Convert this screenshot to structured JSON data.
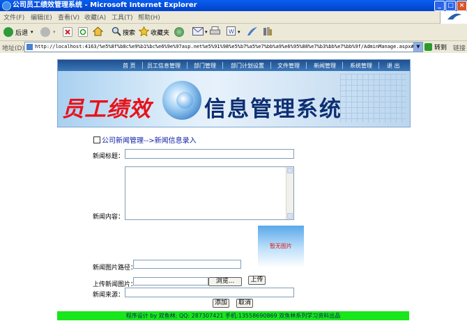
{
  "window": {
    "title": "公司员工绩效管理系统 - Microsoft Internet Explorer",
    "controls": [
      "_",
      "□",
      "×"
    ]
  },
  "menu": {
    "items": [
      "文件(F)",
      "编辑(E)",
      "查看(V)",
      "收藏(A)",
      "工具(T)",
      "帮助(H)"
    ]
  },
  "toolbar": {
    "back_label": "后退",
    "search_label": "搜索",
    "favorites_label": "收藏夹"
  },
  "address": {
    "label": "地址(D)",
    "url": "http://localhost:4163/%e5%8f%b8c%e9%b1%bc%e6%9e%97asp.net%e5%91%98%e5%b7%a5%e7%bb%a9%e6%95%88%e7%b3%bb%e7%bb%9f/AdminManage.aspx#",
    "go_label": "转到",
    "links_label": "链接"
  },
  "nav": {
    "items": [
      "首 页",
      "员工信息管理",
      "部门管理",
      "部门计划设置",
      "文件管理",
      "新闻管理",
      "系统管理",
      "退 出"
    ]
  },
  "banner": {
    "title_left": "员工绩效",
    "title_right": "信息管理系统"
  },
  "breadcrumb": "公司新闻管理-->新闻信息录入",
  "form": {
    "title_label": "新闻标题：",
    "content_label": "新闻内容：",
    "image_path_label": "新闻图片路径：",
    "upload_label": "上传新闻图片：",
    "browse_label": "浏览...",
    "upload_button": "上传",
    "source_label": "新闻来源：",
    "no_image_text": "暂无图片",
    "add_button": "添加",
    "cancel_button": "取消"
  },
  "footer": "程序设计 by 双鱼林; QQ: 287307421 手机:13558690869 双鱼林系列学习资料出品",
  "colors": {
    "footer_bg": "#19e61b",
    "title_left": "#e8121a",
    "title_right": "#0d2f72",
    "breadcrumb": "#1020a8",
    "nav_bg": "#1f4f8f"
  }
}
